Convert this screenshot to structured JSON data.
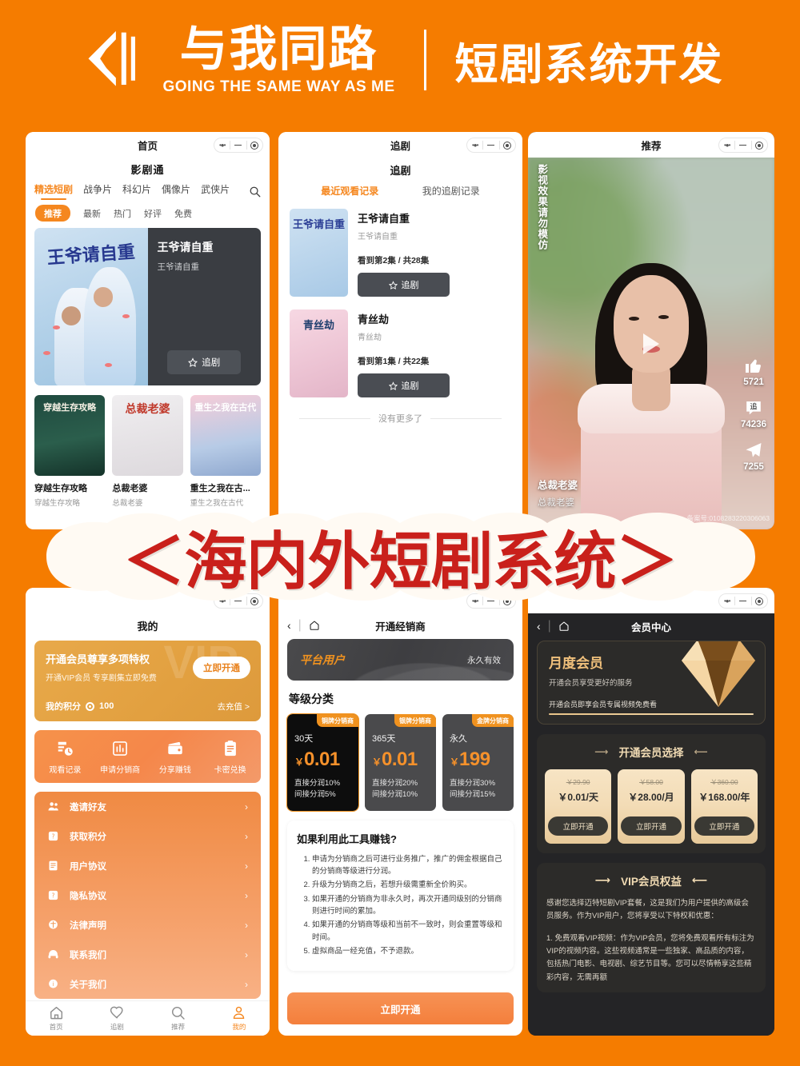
{
  "header": {
    "brand_cn": "与我同路",
    "brand_en": "GOING THE SAME WAY AS ME",
    "subtitle": "短剧系统开发",
    "logo_icon": "bracket-logo-icon",
    "bg_color": "#F57C00"
  },
  "banner": {
    "text": "＜海内外短剧系统＞",
    "color": "#C9201B"
  },
  "phone1": {
    "mp_title": "首页",
    "app_title": "影剧通",
    "categories": [
      "精选短剧",
      "战争片",
      "科幻片",
      "偶像片",
      "武侠片"
    ],
    "search_icon": "search-icon",
    "filters": [
      "推荐",
      "最新",
      "热门",
      "好评",
      "免费"
    ],
    "hero": {
      "poster_text": "王爷请自重",
      "title": "王爷请自重",
      "subtitle": "王爷请自重",
      "follow_label": "追剧",
      "star_icon": "star-icon"
    },
    "grid": [
      {
        "poster_text": "穿越生存攻略",
        "title": "穿越生存攻略",
        "subtitle": "穿越生存攻略"
      },
      {
        "poster_text": "总裁老婆",
        "title": "总裁老婆",
        "subtitle": "总裁老婆"
      },
      {
        "poster_text": "重生之我在古代",
        "title": "重生之我在古...",
        "subtitle": "重生之我在古代"
      }
    ]
  },
  "phone2": {
    "mp_title": "追剧",
    "section_title": "追剧",
    "tabs": [
      "最近观看记录",
      "我的追剧记录"
    ],
    "items": [
      {
        "poster_text": "王爷请自重",
        "title": "王爷请自重",
        "subtitle": "王爷请自重",
        "progress": "看到第2集 / 共28集",
        "btn": "追剧"
      },
      {
        "poster_text": "青丝劫",
        "title": "青丝劫",
        "subtitle": "青丝劫",
        "progress": "看到第1集 / 共22集",
        "btn": "追剧"
      }
    ],
    "no_more": "没有更多了"
  },
  "phone3": {
    "mp_title": "推荐",
    "warning": "影视效果请勿模仿",
    "play_icon": "play-icon",
    "actions": [
      {
        "icon": "thumbs-up-icon",
        "count": "5721"
      },
      {
        "icon": "follow-bubble-icon",
        "count": "74236",
        "glyph": "追"
      },
      {
        "icon": "share-icon",
        "count": "7255"
      }
    ],
    "caption_title": "总裁老婆",
    "caption_sub": "总裁老婆",
    "license": "备案号:0108283220306063"
  },
  "phone4": {
    "title": "我的",
    "vip_card": {
      "headline": "开通会员尊享多项特权",
      "sub": "开通VIP会员 专享剧集立即免费",
      "open_btn": "立即开通",
      "points_label": "我的积分",
      "points_value": "100",
      "recharge": "去充值 >",
      "watermark": "VIP"
    },
    "quick": [
      {
        "icon": "history-icon",
        "label": "观看记录"
      },
      {
        "icon": "chart-icon",
        "label": "申请分销商"
      },
      {
        "icon": "wallet-icon",
        "label": "分享赚钱"
      },
      {
        "icon": "clipboard-icon",
        "label": "卡密兑换"
      }
    ],
    "menu": [
      {
        "icon": "users-icon",
        "label": "邀请好友"
      },
      {
        "icon": "question-icon",
        "label": "获取积分"
      },
      {
        "icon": "doc-icon",
        "label": "用户协议"
      },
      {
        "icon": "shield-question-icon",
        "label": "隐私协议"
      },
      {
        "icon": "balance-icon",
        "label": "法律声明"
      },
      {
        "icon": "headset-icon",
        "label": "联系我们"
      },
      {
        "icon": "info-icon",
        "label": "关于我们"
      }
    ],
    "tabbar": [
      {
        "icon": "home-icon",
        "label": "首页",
        "active": false
      },
      {
        "icon": "heart-icon",
        "label": "追剧",
        "active": false
      },
      {
        "icon": "search-icon",
        "label": "推荐",
        "active": false
      },
      {
        "icon": "person-icon",
        "label": "我的",
        "active": true
      }
    ]
  },
  "phone5": {
    "nav_title": "开通经销商",
    "back_icon": "chevron-left-icon",
    "home_icon": "home-icon",
    "platform_user": "平台用户",
    "validity": "永久有效",
    "level_heading": "等级分类",
    "tiers": [
      {
        "badge": "铜牌分销商",
        "duration": "30天",
        "currency": "￥",
        "price": "0.01",
        "direct": "直接分润10%",
        "indirect": "间接分润5%",
        "selected": true
      },
      {
        "badge": "银牌分销商",
        "duration": "365天",
        "currency": "￥",
        "price": "0.01",
        "direct": "直接分润20%",
        "indirect": "间接分润10%",
        "selected": false
      },
      {
        "badge": "金牌分销商",
        "duration": "永久",
        "currency": "￥",
        "price": "199",
        "direct": "直接分润30%",
        "indirect": "间接分润15%",
        "selected": false
      }
    ],
    "howto_title": "如果利用此工具赚钱?",
    "howto_items": [
      "申请为分销商之后可进行业务推广，推广的佣金根据自己的分销商等级进行分润。",
      "升级为分销商之后，若想升级需重新全价购买。",
      "如果开通的分销商为非永久时，再次开通同级别的分销商则进行时间的累加。",
      "如果开通的分销商等级和当前不一致时，则会重置等级和时间。",
      "虚拟商品一经充值，不予退款。"
    ],
    "cta": "立即开通"
  },
  "phone6": {
    "nav_title": "会员中心",
    "back_icon": "chevron-left-icon",
    "home_icon": "home-icon",
    "member_card": {
      "title": "月度会员",
      "sub": "开通会员享受更好的服务",
      "note": "开通会员即享会员专属视频免费看",
      "gem_icon": "diamond-icon"
    },
    "pick_title": "开通会员选择",
    "plans": [
      {
        "old_price": "￥29.90",
        "price": "￥0.01/天",
        "btn": "立即开通"
      },
      {
        "old_price": "￥58.00",
        "price": "￥28.00/月",
        "btn": "立即开通"
      },
      {
        "old_price": "￥360.00",
        "price": "￥168.00/年",
        "btn": "立即开通"
      }
    ],
    "benefits_title": "VIP会员权益",
    "benefits_p1": "感谢您选择迈特短剧VIP套餐，这是我们为用户提供的高级会员服务。作为VIP用户，您将享受以下特权和优惠：",
    "benefits_p2": "1. 免费观看VIP视频：作为VIP会员，您将免费观看所有标注为VIP的视频内容。这些视频通常是一些独家、高品质的内容，包括热门电影、电视剧、综艺节目等。您可以尽情畅享这些精彩内容，无需再额"
  }
}
